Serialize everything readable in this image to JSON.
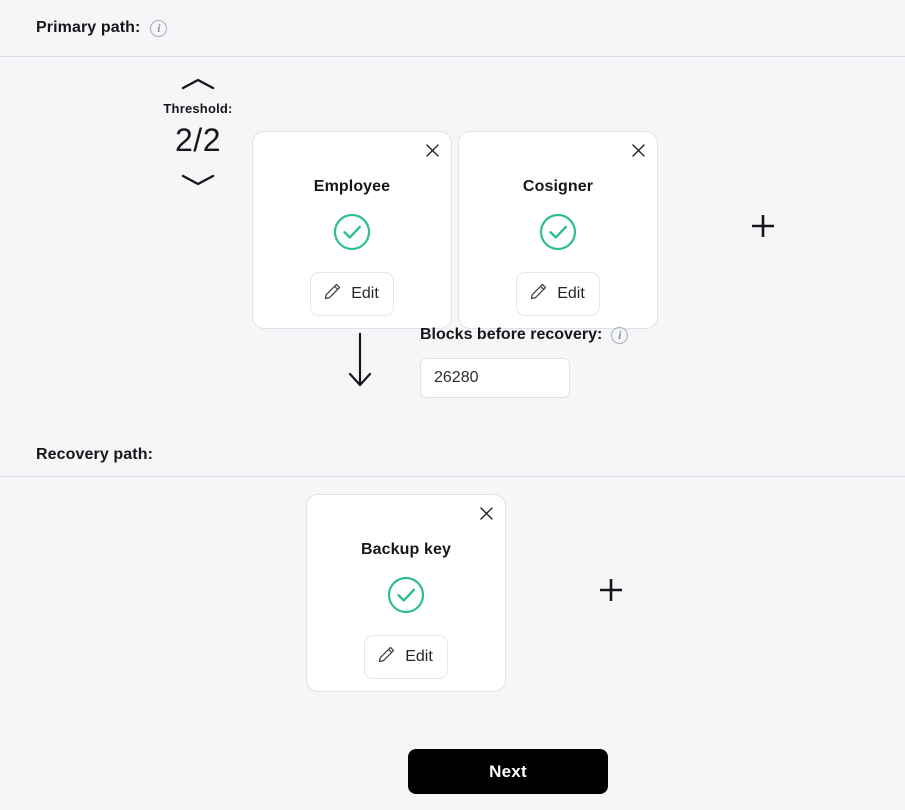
{
  "primary": {
    "header_label": "Primary path:",
    "info_icon": "info-icon",
    "info_glyph": "i",
    "threshold": {
      "up_icon": "chevron-up-icon",
      "down_icon": "chevron-down-icon",
      "label": "Threshold:",
      "value": "2/2"
    },
    "add_icon": "plus-icon",
    "cards": [
      {
        "title": "Employee",
        "close_icon": "close-icon",
        "close_glyph": "×",
        "status_icon": "check-circle-icon",
        "edit_label": "Edit",
        "edit_icon": "pencil-icon"
      },
      {
        "title": "Cosigner",
        "close_icon": "close-icon",
        "close_glyph": "×",
        "status_icon": "check-circle-icon",
        "edit_label": "Edit",
        "edit_icon": "pencil-icon"
      }
    ]
  },
  "blocks": {
    "arrow_icon": "arrow-down-icon",
    "label": "Blocks before recovery:",
    "info_icon": "info-icon",
    "info_glyph": "i",
    "value": "26280",
    "placeholder": "26280"
  },
  "recovery": {
    "header_label": "Recovery path:",
    "add_icon": "plus-icon",
    "cards": [
      {
        "title": "Backup key",
        "close_icon": "close-icon",
        "close_glyph": "×",
        "status_icon": "check-circle-icon",
        "edit_label": "Edit",
        "edit_icon": "pencil-icon"
      }
    ]
  },
  "footer": {
    "next_label": "Next"
  },
  "colors": {
    "background": "#f5f6f8",
    "card_background": "#ffffff",
    "border": "#dfe2e8",
    "divider": "#dcdfe6",
    "success_green": "#2ebd8e",
    "text_primary": "#16171a",
    "button_primary": "#000000"
  }
}
